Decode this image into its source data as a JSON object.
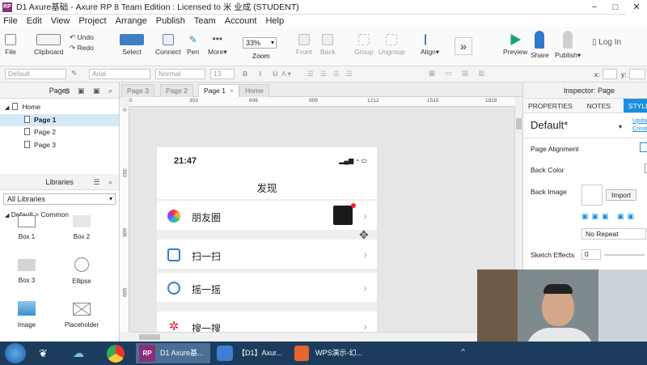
{
  "window": {
    "app_badge": "RP",
    "title": "D1 Axure基础 - Axure RP 8 Team Edition : Licensed to 米 业成 (STUDENT)",
    "minimize": "−",
    "maximize": "□",
    "close": "✕"
  },
  "menu": [
    "File",
    "Edit",
    "View",
    "Project",
    "Arrange",
    "Publish",
    "Team",
    "Account",
    "Help"
  ],
  "toolbar": {
    "file": "File",
    "clipboard": "Clipboard",
    "undo": "Undo",
    "redo": "Redo",
    "select": "Select",
    "connect": "Connect",
    "pen": "Pen",
    "more": "More",
    "zoom_value": "33%",
    "zoom": "Zoom",
    "front": "Front",
    "back": "Back",
    "group": "Group",
    "ungroup": "Ungroup",
    "align": "Align",
    "preview": "Preview",
    "share": "Share",
    "publish": "Publish",
    "login": "Log In"
  },
  "format": {
    "style": "Default",
    "font": "Arial",
    "weight": "Normal",
    "size": "13",
    "x_label": "x:",
    "y_label": "y:"
  },
  "pages": {
    "header": "Pages",
    "items": [
      {
        "label": "Home",
        "level": 0
      },
      {
        "label": "Page 1",
        "level": 1,
        "selected": true
      },
      {
        "label": "Page 2",
        "level": 1
      },
      {
        "label": "Page 3",
        "level": 1
      }
    ]
  },
  "libraries": {
    "header": "Libraries",
    "selected": "All Libraries",
    "category": "Default > Common",
    "widgets": [
      "Box 1",
      "Box 2",
      "Box 3",
      "Ellipse",
      "Image",
      "Placeholder"
    ]
  },
  "tabs": [
    {
      "label": "Page 3",
      "active": false
    },
    {
      "label": "Page 2",
      "active": false
    },
    {
      "label": "Page 1",
      "active": true
    },
    {
      "label": "Home",
      "active": false
    }
  ],
  "ruler": {
    "h": [
      "0",
      "303",
      "606",
      "909",
      "1212",
      "1515",
      "1818"
    ],
    "v": [
      "0",
      "303",
      "606",
      "909"
    ]
  },
  "phone": {
    "time": "21:47",
    "status": "▂▄▆ ◔ ▭",
    "title": "发现",
    "rows": [
      "朋友圈",
      "扫一扫",
      "摇一摇",
      "搜一搜"
    ],
    "chevron": "›"
  },
  "inspector": {
    "header": "Inspector: Page",
    "tabs": [
      "PROPERTIES",
      "NOTES",
      "STYLE"
    ],
    "style_name": "Default*",
    "update": "Update",
    "create": "Create",
    "page_alignment": "Page Alignment",
    "back_color": "Back Color",
    "back_image": "Back Image",
    "import": "Import",
    "no_repeat": "No Repeat",
    "sketch_effects": "Sketch Effects",
    "sketch_value": "0"
  },
  "taskbar": [
    {
      "label": "D1 Axure基...",
      "active": true
    },
    {
      "label": "【D1】Axur...",
      "active": false
    },
    {
      "label": "WPS演示-幻...",
      "active": false
    }
  ],
  "colors": {
    "accent": "#1a8fe0",
    "axure_purple": "#8a2f7a",
    "taskbar": "#1c3c5e",
    "preview_green": "#18a56b"
  }
}
